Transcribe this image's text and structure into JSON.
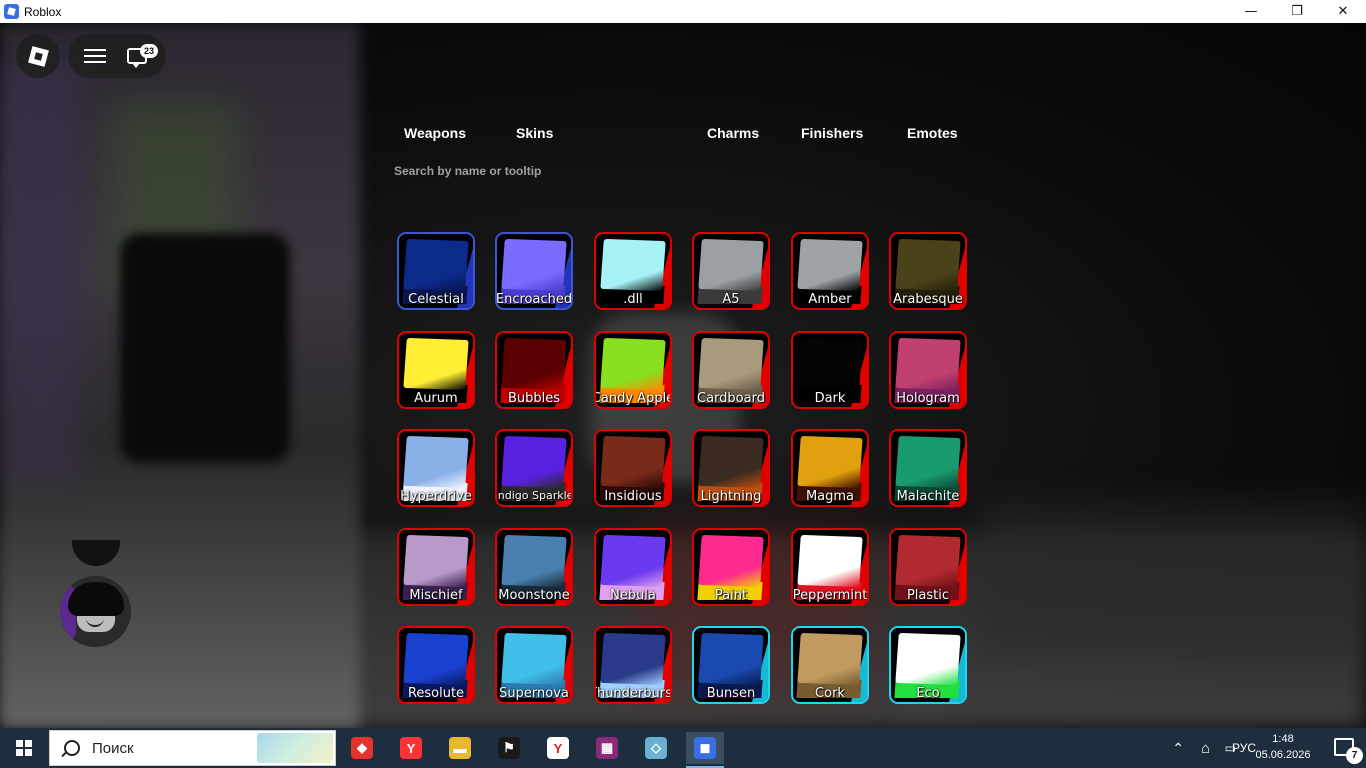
{
  "window": {
    "title": "Roblox",
    "controls": {
      "minimize": "—",
      "restore": "❐",
      "close": "✕"
    }
  },
  "hud": {
    "chat_badge": "23"
  },
  "tabs": [
    "Weapons",
    "Skins",
    "Charms",
    "Finishers",
    "Emotes"
  ],
  "search": {
    "placeholder": "Search by name or tooltip"
  },
  "items": [
    {
      "name": "Celestial",
      "border": "blue",
      "top": "#0b2a8a",
      "bottom": "#0a1650"
    },
    {
      "name": "Encroached",
      "border": "blue",
      "top": "#7a6cff",
      "bottom": "#4a3cd0"
    },
    {
      "name": ".dll",
      "border": "red",
      "top": "#a7f2f6",
      "bottom": "#000000"
    },
    {
      "name": "A5",
      "border": "red",
      "top": "#9aa0a4",
      "bottom": "#3a3a3a"
    },
    {
      "name": "Amber",
      "border": "red",
      "top": "#9ea3a6",
      "bottom": "#000000"
    },
    {
      "name": "Arabesque",
      "border": "red",
      "top": "#4a4218",
      "bottom": "#241f0a"
    },
    {
      "name": "Aurum",
      "border": "red",
      "top": "#ffee33",
      "bottom": "#000000"
    },
    {
      "name": "Bubbles",
      "border": "red",
      "top": "#5a0000",
      "bottom": "#c00000"
    },
    {
      "name": "Candy Apple",
      "border": "red",
      "top": "#88e020",
      "bottom": "#ff8800"
    },
    {
      "name": "Cardboard",
      "border": "red",
      "top": "#a89a7c",
      "bottom": "#6a5e48"
    },
    {
      "name": "Dark",
      "border": "red",
      "top": "#050505",
      "bottom": "#000000"
    },
    {
      "name": "Hologram",
      "border": "red",
      "top": "#c04070",
      "bottom": "#7a2060"
    },
    {
      "name": "Hyperdrive",
      "border": "red",
      "top": "#8ab0e8",
      "bottom": "#f0f4ff"
    },
    {
      "name": "Indigo Sparkle",
      "border": "red",
      "top": "#5a20e0",
      "bottom": "#2a2a2a"
    },
    {
      "name": "Insidious",
      "border": "red",
      "top": "#7a2a18",
      "bottom": "#2a0a06"
    },
    {
      "name": "Lightning",
      "border": "red",
      "top": "#3a2a20",
      "bottom": "#c05010"
    },
    {
      "name": "Magma",
      "border": "red",
      "top": "#e0a010",
      "bottom": "#401000"
    },
    {
      "name": "Malachite",
      "border": "red",
      "top": "#1a9a70",
      "bottom": "#0a4a34"
    },
    {
      "name": "Mischief",
      "border": "red",
      "top": "#b89ac8",
      "bottom": "#3a2050"
    },
    {
      "name": "Moonstone",
      "border": "red",
      "top": "#4a80b0",
      "bottom": "#1a2a3a"
    },
    {
      "name": "Nebula",
      "border": "red",
      "top": "#6a3af0",
      "bottom": "#e0a0f0"
    },
    {
      "name": "Paint",
      "border": "red",
      "top": "#ff2a90",
      "bottom": "#f0d000"
    },
    {
      "name": "Peppermint",
      "border": "red",
      "top": "#ffffff",
      "bottom": "#e01020"
    },
    {
      "name": "Plastic",
      "border": "red",
      "top": "#b02a30",
      "bottom": "#701018"
    },
    {
      "name": "Resolute",
      "border": "red",
      "top": "#1a40d0",
      "bottom": "#0a1860"
    },
    {
      "name": "Supernova",
      "border": "red",
      "top": "#40c0e8",
      "bottom": "#2a7ab0"
    },
    {
      "name": "Thunderburst",
      "border": "red",
      "top": "#2a3a8a",
      "bottom": "#a0d0ff"
    },
    {
      "name": "Bunsen",
      "border": "cyan",
      "top": "#1a4ab0",
      "bottom": "#0a1a50"
    },
    {
      "name": "Cork",
      "border": "cyan",
      "top": "#c09a60",
      "bottom": "#7a5a30"
    },
    {
      "name": "Eco",
      "border": "cyan",
      "top": "#ffffff",
      "bottom": "#20e040"
    }
  ],
  "taskbar": {
    "search_text": "Поиск",
    "apps": [
      {
        "name": "anydesk-icon",
        "color": "#e8322c",
        "glyph": "◆"
      },
      {
        "name": "yandex-icon",
        "color": "#ff3333",
        "glyph": "Y"
      },
      {
        "name": "file-explorer-icon",
        "color": "#e8b830",
        "glyph": "▬"
      },
      {
        "name": "exit-app-icon",
        "color": "#1a1a1a",
        "glyph": "⚑"
      },
      {
        "name": "yandex-browser-icon",
        "color": "#ffffff",
        "glyph": "Y"
      },
      {
        "name": "winrar-icon",
        "color": "#8a2a7a",
        "glyph": "▦"
      },
      {
        "name": "crystal-app-icon",
        "color": "#6ab0d0",
        "glyph": "◇"
      },
      {
        "name": "roblox-icon",
        "color": "#3a6ee8",
        "glyph": "◼"
      }
    ],
    "lang": "РУС",
    "time": "1:48",
    "date": "05.06.2026",
    "notifications": "7"
  }
}
